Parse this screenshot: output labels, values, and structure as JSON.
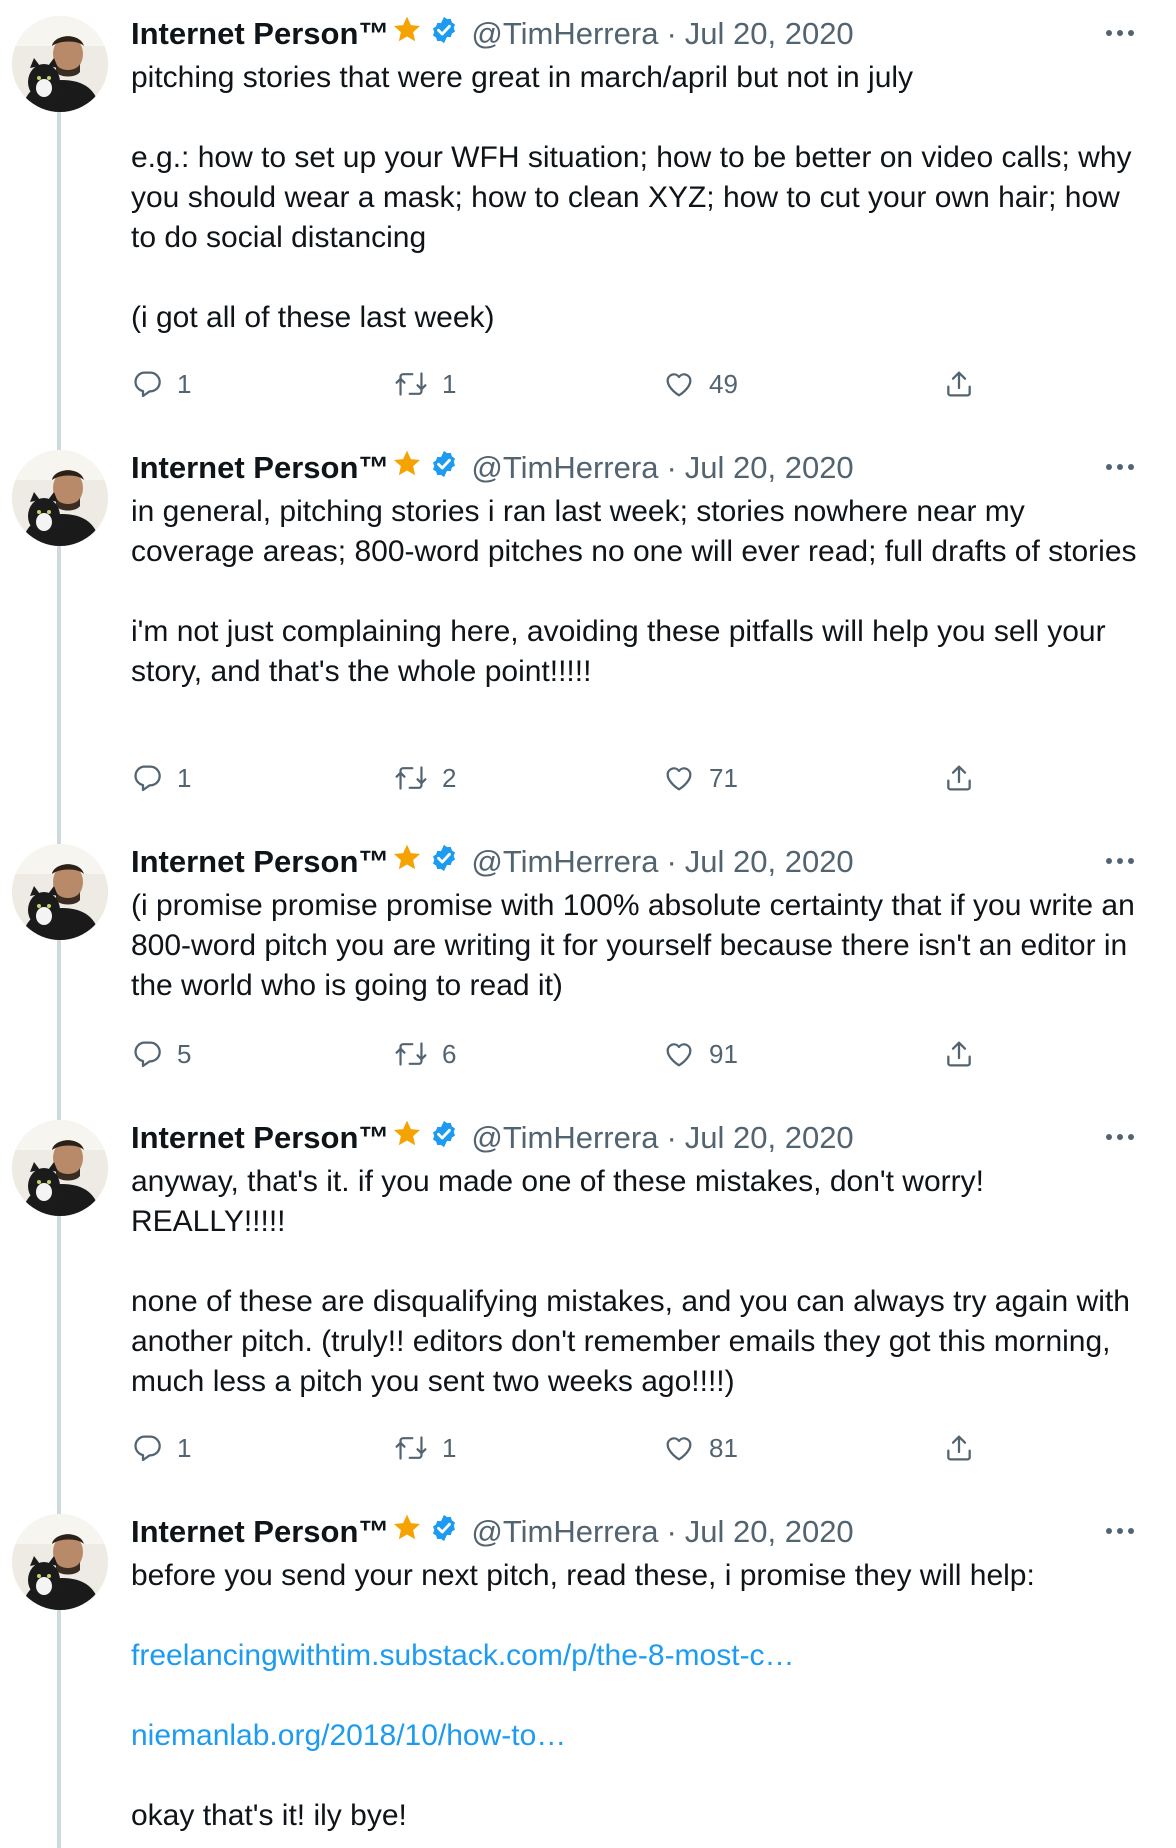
{
  "author": {
    "name": "Internet Person™",
    "handle": "@TimHerrera",
    "separator": "·",
    "date": "Jul 20, 2020"
  },
  "colors": {
    "link": "#1d9bf0",
    "verified": "#1d9bf0",
    "star": "#f4a300",
    "secondary_text": "#536471",
    "thread_line": "#cfd9de"
  },
  "icons": [
    "avatar-photo",
    "star-icon",
    "verified-badge-icon",
    "more-icon",
    "reply-icon",
    "retweet-icon",
    "like-icon",
    "share-icon"
  ],
  "tweets": [
    {
      "paragraphs": [
        "pitching stories that were great in march/april but not in july",
        "e.g.: how to set up your WFH situation; how to be better on video calls; why you should wear a mask; how to clean XYZ; how to cut your own hair; how to do social distancing",
        "(i got all of these last week)"
      ],
      "replies": "1",
      "retweets": "1",
      "likes": "49"
    },
    {
      "paragraphs": [
        "in general, pitching stories i ran last week; stories nowhere near my coverage areas; 800-word pitches no one will ever read; full drafts of stories",
        "i'm not just complaining here, avoiding these pitfalls will help you sell your story, and that's the whole point!!!!!"
      ],
      "replies": "1",
      "retweets": "2",
      "likes": "71"
    },
    {
      "paragraphs": [
        "(i promise promise promise with 100% absolute certainty that if you write an 800-word pitch you are writing it for yourself because there isn't an editor in the world who is going to read it)"
      ],
      "replies": "5",
      "retweets": "6",
      "likes": "91"
    },
    {
      "paragraphs": [
        "anyway, that's it. if you made one of these mistakes, don't worry! REALLY!!!!!",
        "none of these are disqualifying mistakes, and you can always try again with another pitch. (truly!! editors don't remember emails they got this morning, much less a pitch you sent two weeks ago!!!!)"
      ],
      "replies": "1",
      "retweets": "1",
      "likes": "81"
    },
    {
      "paragraphs": [
        "before you send your next pitch, read these, i promise they will help:"
      ],
      "links": [
        "freelancingwithtim.substack.com/p/the-8-most-c…",
        "niemanlab.org/2018/10/how-to…"
      ],
      "closing": "okay that's it! ily bye!"
    }
  ]
}
